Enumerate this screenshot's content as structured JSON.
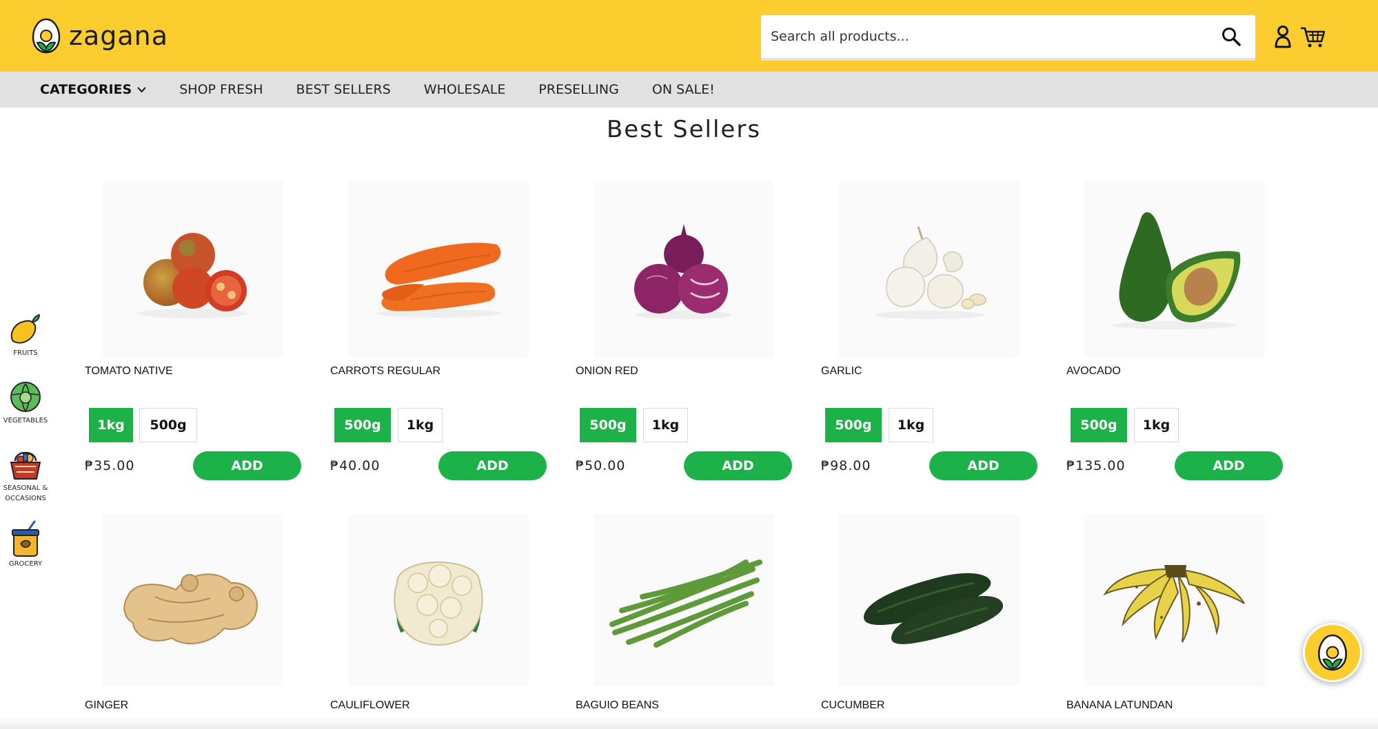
{
  "brand": {
    "name": "zagana",
    "accent": "#fccd2f",
    "green": "#1db14a"
  },
  "search": {
    "placeholder": "Search all products..."
  },
  "nav": {
    "categories_label": "CATEGORIES",
    "items": [
      "SHOP FRESH",
      "BEST SELLERS",
      "WHOLESALE",
      "PRESELLING",
      "ON SALE!"
    ]
  },
  "page_title": "Best Sellers",
  "side_categories": [
    {
      "label": "FRUITS",
      "icon": "mango-icon"
    },
    {
      "label": "VEGETABLES",
      "icon": "cabbage-icon"
    },
    {
      "label": "SEASONAL &",
      "label2": "OCCASIONS",
      "icon": "gift-basket-icon"
    },
    {
      "label": "GROCERY",
      "icon": "grocery-jar-icon"
    }
  ],
  "products": [
    {
      "name": "TOMATO NATIVE",
      "variants": [
        "1kg",
        "500g"
      ],
      "selected": 0,
      "price": "₱35.00",
      "add_label": "ADD",
      "icon": "tomato-image"
    },
    {
      "name": "CARROTS REGULAR",
      "variants": [
        "500g",
        "1kg"
      ],
      "selected": 0,
      "price": "₱40.00",
      "add_label": "ADD",
      "icon": "carrot-image"
    },
    {
      "name": "ONION RED",
      "variants": [
        "500g",
        "1kg"
      ],
      "selected": 0,
      "price": "₱50.00",
      "add_label": "ADD",
      "icon": "red-onion-image"
    },
    {
      "name": "GARLIC",
      "variants": [
        "500g",
        "1kg"
      ],
      "selected": 0,
      "price": "₱98.00",
      "add_label": "ADD",
      "icon": "garlic-image"
    },
    {
      "name": "AVOCADO",
      "variants": [
        "500g",
        "1kg"
      ],
      "selected": 0,
      "price": "₱135.00",
      "add_label": "ADD",
      "icon": "avocado-image"
    },
    {
      "name": "GINGER",
      "icon": "ginger-image"
    },
    {
      "name": "CAULIFLOWER",
      "icon": "cauliflower-image"
    },
    {
      "name": "BAGUIO BEANS",
      "icon": "green-beans-image"
    },
    {
      "name": "CUCUMBER",
      "icon": "cucumber-image"
    },
    {
      "name": "BANANA LATUNDAN",
      "icon": "banana-image"
    }
  ]
}
